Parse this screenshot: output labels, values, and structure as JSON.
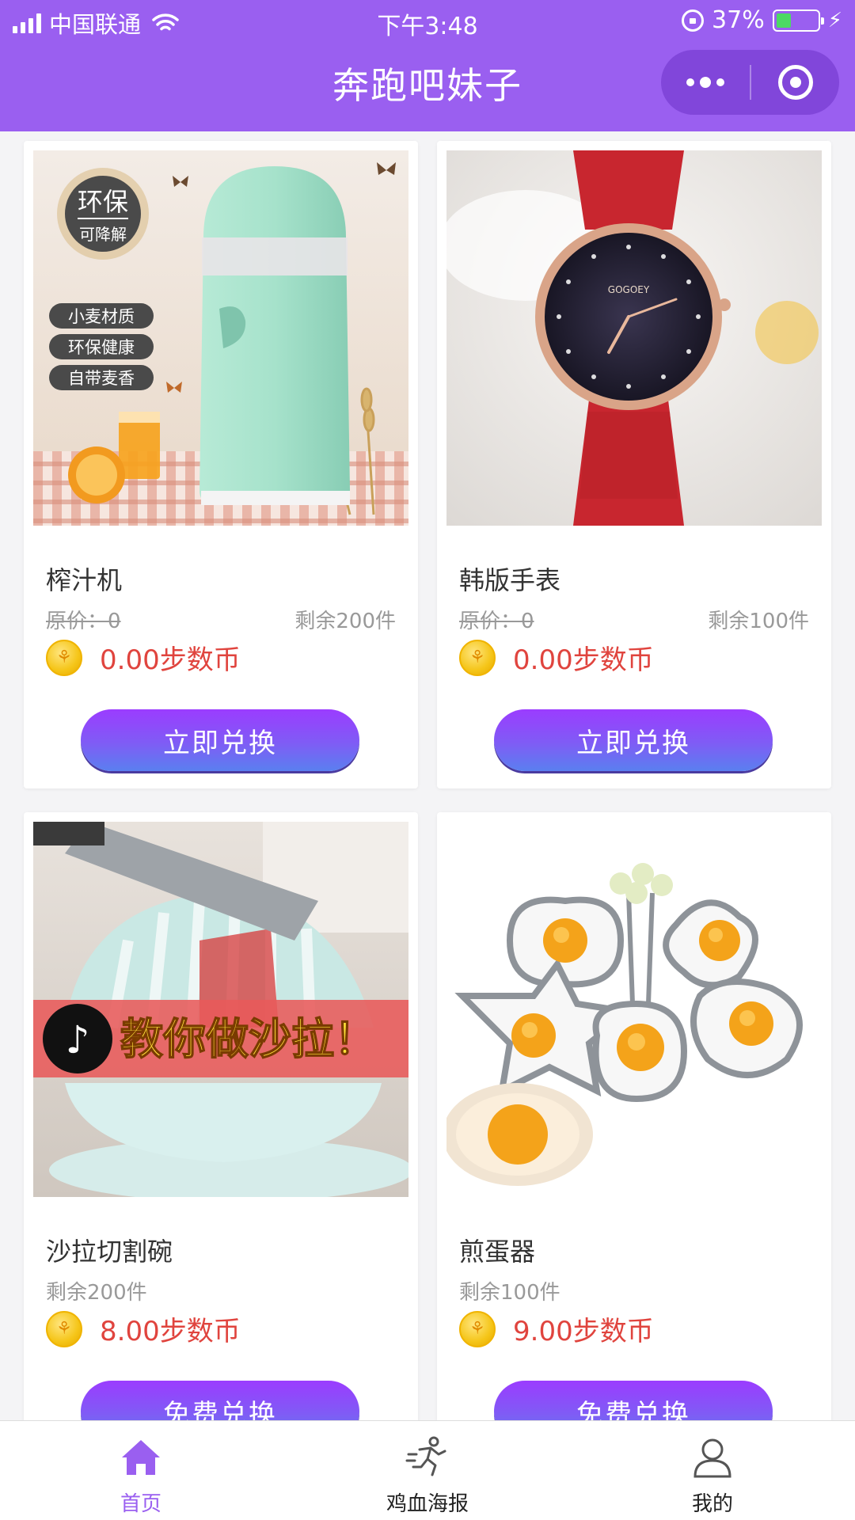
{
  "status_bar": {
    "carrier": "中国联通",
    "time": "下午3:48",
    "battery": "37%",
    "battery_level": 0.37
  },
  "header": {
    "title": "奔跑吧妹子",
    "capsule": {
      "more_icon": "more-dots-icon",
      "close_icon": "target-icon"
    }
  },
  "products": [
    {
      "name": "榨汁机",
      "original_price": "原价：0",
      "stock": "剩余200件",
      "price": "0.00步数币",
      "button": "立即兑换",
      "image_text": {
        "badge_main": "环保",
        "badge_sub": "可降解",
        "tags": [
          "小麦材质",
          "环保健康",
          "自带麦香"
        ]
      }
    },
    {
      "name": "韩版手表",
      "original_price": "原价：0",
      "stock": "剩余100件",
      "price": "0.00步数币",
      "button": "立即兑换",
      "image_text": {
        "brand": "GOGOEY"
      }
    },
    {
      "name": "沙拉切割碗",
      "stock": "剩余200件",
      "price": "8.00步数币",
      "button": "免费兑换",
      "image_text": {
        "banner": "教你做沙拉！"
      }
    },
    {
      "name": "煎蛋器",
      "stock": "剩余100件",
      "price": "9.00步数币",
      "button": "免费兑换"
    }
  ],
  "tabbar": [
    {
      "label": "首页",
      "icon": "home-icon",
      "active": true
    },
    {
      "label": "鸡血海报",
      "icon": "runner-icon",
      "active": false
    },
    {
      "label": "我的",
      "icon": "user-icon",
      "active": false
    }
  ],
  "colors": {
    "header": "#9a5ff0",
    "price": "#e0443e",
    "tab_active": "#9a5ff0",
    "button_gradient_top": "#9b3cff",
    "button_gradient_bottom": "#5a7ff0"
  }
}
